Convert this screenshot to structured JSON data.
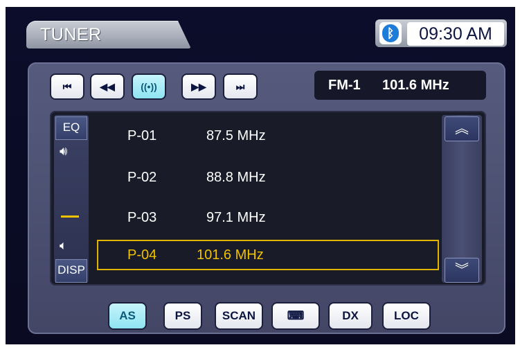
{
  "header": {
    "title": "TUNER",
    "clock": "09:30 AM",
    "bluetooth_icon": "bluetooth-icon"
  },
  "controls": [
    {
      "name": "skip-back-button",
      "icon": "skip-back-icon",
      "glyph": "⏮"
    },
    {
      "name": "rewind-button",
      "icon": "rewind-icon",
      "glyph": "◀◀"
    },
    {
      "name": "antenna-button",
      "icon": "antenna-icon",
      "glyph": "((•))"
    },
    {
      "name": "fast-forward-button",
      "icon": "fast-forward-icon",
      "glyph": "▶▶"
    },
    {
      "name": "skip-forward-button",
      "icon": "skip-forward-icon",
      "glyph": "⏭"
    }
  ],
  "display": {
    "band": "FM-1",
    "frequency": "101.6 MHz"
  },
  "side": {
    "eq_label": "EQ",
    "disp_label": "DISP"
  },
  "presets": [
    {
      "preset": "P-01",
      "frequency": "87.5 MHz"
    },
    {
      "preset": "P-02",
      "frequency": "88.8 MHz"
    },
    {
      "preset": "P-03",
      "frequency": "97.1 MHz"
    },
    {
      "preset": "P-04",
      "frequency": "101.6 MHz",
      "selected": true
    }
  ],
  "bottom": {
    "as": "AS",
    "ps": "PS",
    "scan": "SCAN",
    "keyboard_icon": "keyboard-icon",
    "dx": "DX",
    "loc": "LOC"
  },
  "colors": {
    "accent": "#8fe4f2",
    "selection": "#e3b400",
    "background": "#0b0d2a"
  }
}
